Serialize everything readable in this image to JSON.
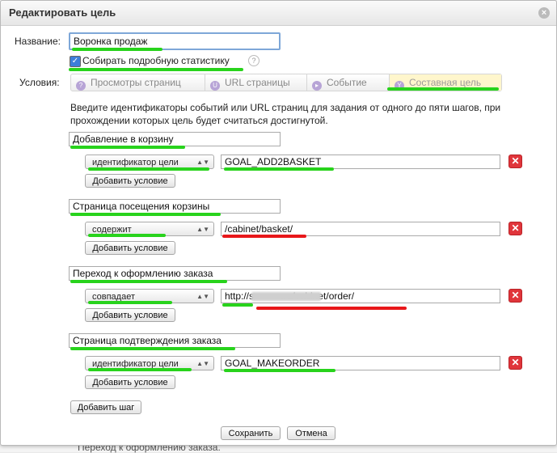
{
  "dialog": {
    "title": "Редактировать цель",
    "close_icon": "close-icon"
  },
  "form": {
    "name_label": "Название:",
    "name_value": "Воронка продаж",
    "stats_label": "Собирать подробную статистику",
    "stats_checked": true,
    "help_mark": "?",
    "conditions_label": "Условия:"
  },
  "tabs": [
    {
      "label": "Просмотры страниц",
      "icon": "page-views-icon"
    },
    {
      "label": "URL страницы",
      "icon": "url-icon"
    },
    {
      "label": "Событие",
      "icon": "event-icon"
    },
    {
      "label": "Составная цель",
      "icon": "composite-icon"
    }
  ],
  "instructions": "Введите идентификаторы событий или URL страниц для задания от одного до пяти шагов, при прохождении которых цель будет считаться достигнутой.",
  "steps": [
    {
      "name": "Добавление в корзину",
      "condition": "идентификатор цели",
      "value": "GOAL_ADD2BASKET",
      "add_condition": "Добавить условие"
    },
    {
      "name": "Страница посещения корзины",
      "condition": "содержит",
      "value": "/cabinet/basket/",
      "add_condition": "Добавить условие"
    },
    {
      "name": "Переход к оформлению заказа",
      "condition": "совпадает",
      "value": "http://s          .ru/cabinet/order/",
      "add_condition": "Добавить условие"
    },
    {
      "name": "Страница подтверждения заказа",
      "condition": "идентификатор цели",
      "value": "GOAL_MAKEORDER",
      "add_condition": "Добавить условие"
    }
  ],
  "add_step": "Добавить шаг",
  "save": "Сохранить",
  "cancel": "Отмена",
  "background_text": "Переход к оформлению заказа.",
  "colors": {
    "highlight_green": "#28d31c",
    "highlight_red": "#e8171a",
    "delete_red": "#e0353b",
    "active_tab": "#fff6cc"
  }
}
